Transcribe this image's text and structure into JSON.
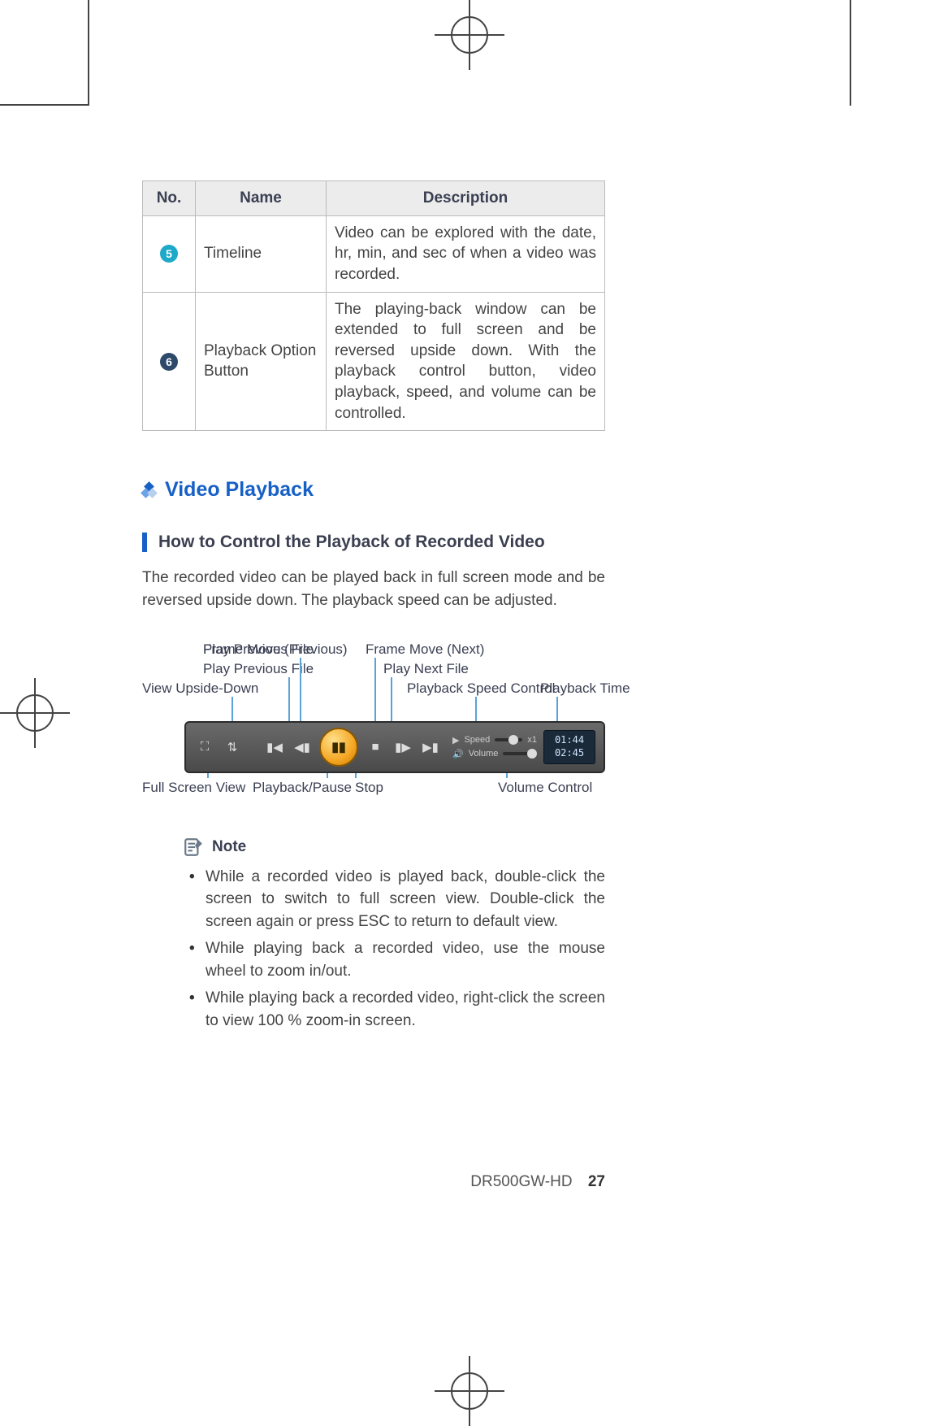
{
  "table": {
    "headers": {
      "no": "No.",
      "name": "Name",
      "desc": "Description"
    },
    "rows": [
      {
        "num": "5",
        "name": "Timeline",
        "desc": "Video can be explored with the date, hr, min, and sec of when a video was recorded."
      },
      {
        "num": "6",
        "name": "Playback Option Button",
        "desc": "The playing-back window can be extended to full screen and be reversed upside down. With the playback control button, video playback, speed, and volume can be controlled."
      }
    ]
  },
  "section_title": "Video Playback",
  "sub_title": "How to Control the Playback of Recorded Video",
  "paragraph": "The recorded video can be played back in full screen mode and be reversed upside down. The playback speed can be adjusted.",
  "callouts": {
    "frame_prev": "Frame Move (Previous)",
    "play_prev": "Play Previous File",
    "upside": "View Upside-Down",
    "frame_next": "Frame Move (Next)",
    "play_next": "Play Next File",
    "speed": "Playback Speed Control",
    "time": "Playback Time",
    "fullscreen": "Full Screen View",
    "playpause": "Playback/Pause",
    "stop": "Stop",
    "volume": "Volume Control"
  },
  "playback_bar": {
    "speed_label": "Speed",
    "volume_label": "Volume",
    "speed_value": "x1",
    "time_top": "01:44",
    "time_bottom": "02:45"
  },
  "note_title": "Note",
  "notes": [
    "While a recorded video is played back, double-click the screen to switch to full screen view. Double-click the screen again or press ESC to return to default view.",
    "While playing back a recorded video, use the mouse wheel to zoom in/out.",
    "While playing back a recorded video, right-click the screen to view 100 % zoom-in screen."
  ],
  "footer_model": "DR500GW-HD",
  "footer_page": "27"
}
